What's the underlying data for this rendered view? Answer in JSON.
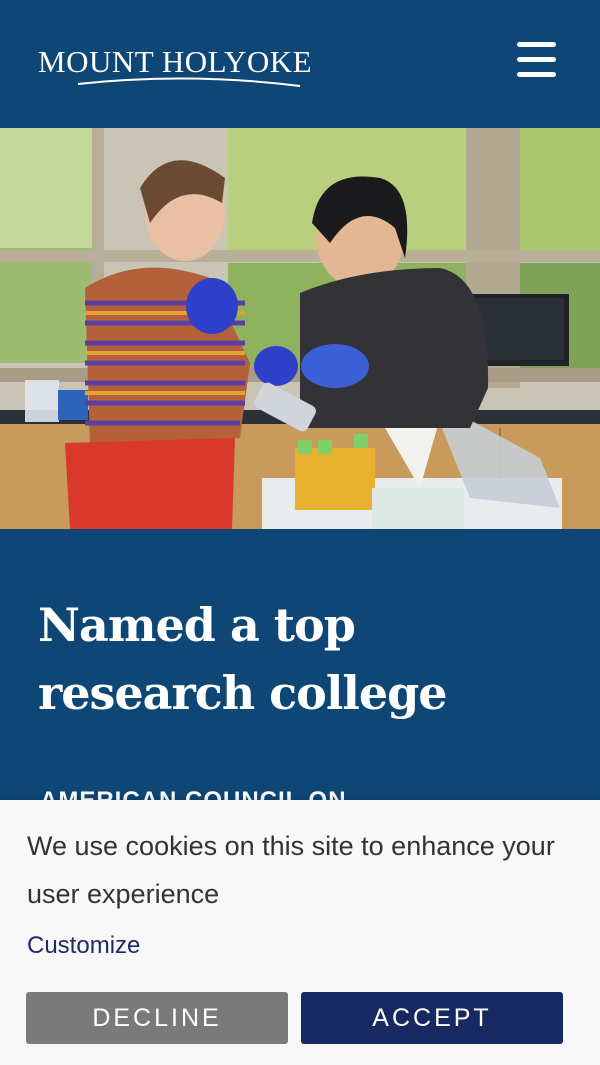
{
  "header": {
    "logo_text": "MOUNT HOLYOKE",
    "menu_icon": "hamburger-menu-icon"
  },
  "hero": {
    "image": "students-in-lab-photo"
  },
  "feature": {
    "title": "Named a top research college",
    "source": "AMERICAN COUNCIL ON"
  },
  "cookie_banner": {
    "message": "We use cookies on this site to enhance your user experience",
    "customize_label": "Customize",
    "decline_label": "DECLINE",
    "accept_label": "ACCEPT"
  },
  "colors": {
    "brand_navy": "#0e4776",
    "accept_navy": "#172863",
    "decline_gray": "#7a7a7a",
    "banner_bg": "#f8f8f8"
  }
}
